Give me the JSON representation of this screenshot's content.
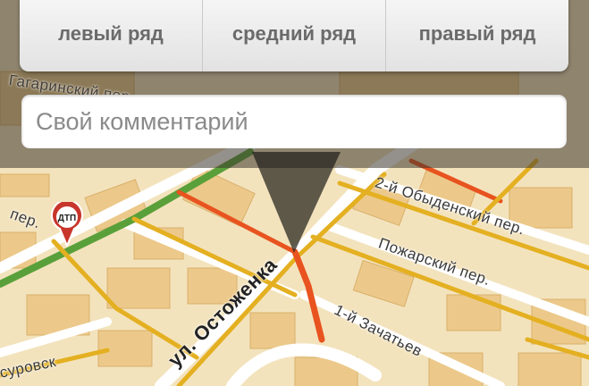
{
  "lane_selector": {
    "left": "левый ряд",
    "middle": "средний ряд",
    "right": "правый ряд"
  },
  "comment_field": {
    "placeholder": "Свой комментарий",
    "value": ""
  },
  "map": {
    "streets": {
      "ostozhenka": "ул. Остоженка",
      "obydensky": "2-й Обыденский пер.",
      "pozharsky": "Пожарский пер.",
      "zachatyevsky": "1-й Зачатьев",
      "gagarinsky": "Гагаринский пер.",
      "per_left": "пер.",
      "surovsky": "суровск"
    },
    "incident_marker": "ДТП"
  },
  "colors": {
    "jam": "#e8531f",
    "slow": "#e4b021",
    "free": "#5aa03a",
    "road": "#ffffff",
    "building": "#ecc98a"
  }
}
